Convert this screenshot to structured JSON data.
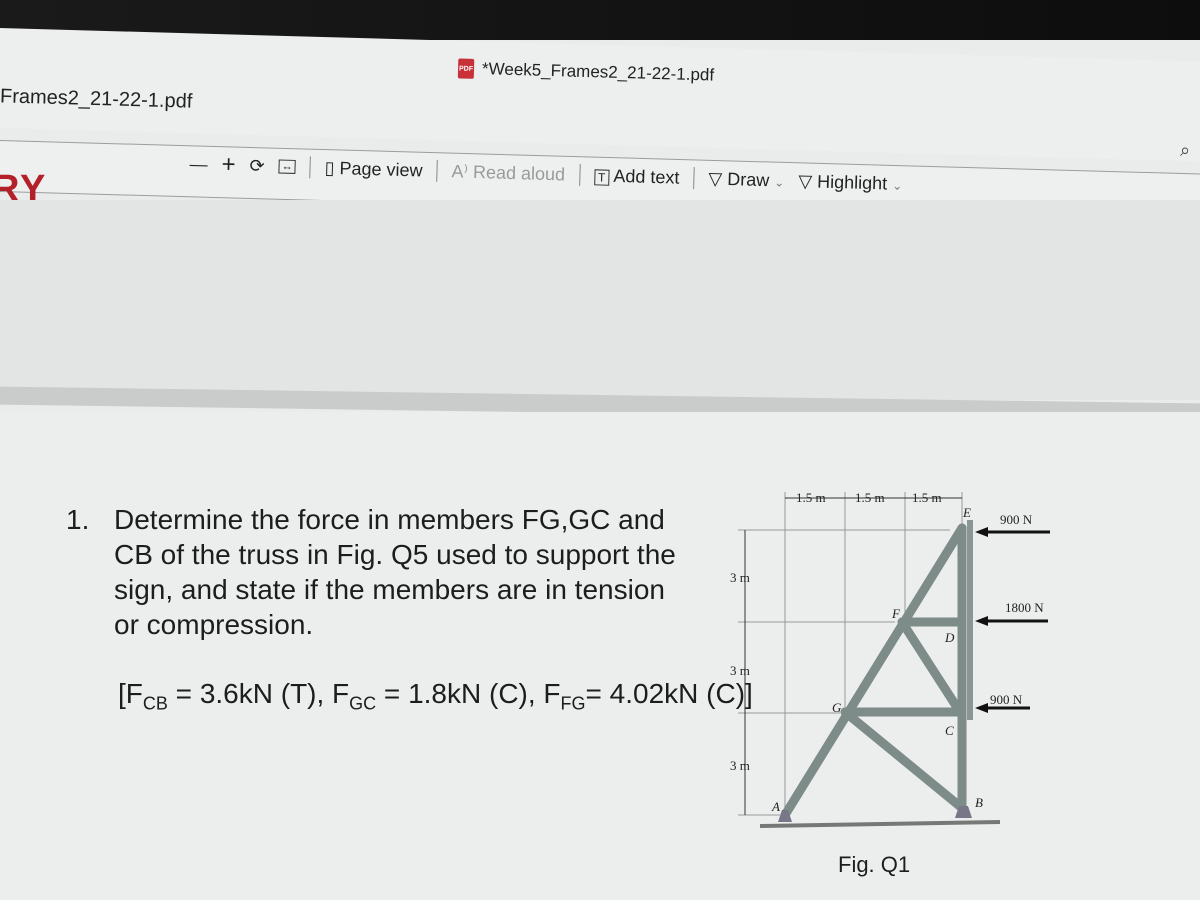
{
  "window": {
    "tab_title": "*Week5_Frames2_21-22-1.pdf",
    "tab_left": "Frames2_21-22-1.pdf",
    "pdf_badge": "PDF"
  },
  "toolbar": {
    "zoom_out": "—",
    "zoom_in": "+",
    "page_view": "Page view",
    "read_aloud": "Read aloud",
    "add_text": "Add text",
    "draw": "Draw",
    "highlight": "Highlight"
  },
  "background_text": "RY",
  "document": {
    "question_number": "1.",
    "question": "Determine the force in members FG,GC and CB of the truss in Fig. Q5 used to support the sign, and state if the members are in tension or compression.",
    "answer": {
      "open": "[F",
      "cb_sub": "CB",
      "cb_val": " = 3.6kN (T), F",
      "gc_sub": "GC",
      "gc_val": " = 1.8kN (C), F",
      "fg_sub": "FG",
      "fg_val": " = 4.02kN (C)]"
    }
  },
  "figure": {
    "caption": "Fig. Q1",
    "dims_h": [
      "1.5 m",
      "1.5 m",
      "1.5 m"
    ],
    "dims_v": [
      "3 m",
      "3 m",
      "3 m"
    ],
    "nodes": [
      "A",
      "B",
      "C",
      "D",
      "E",
      "F",
      "G"
    ],
    "loads": [
      "900 N",
      "1800 N",
      "900 N"
    ],
    "member_color": "#7d8c88"
  }
}
